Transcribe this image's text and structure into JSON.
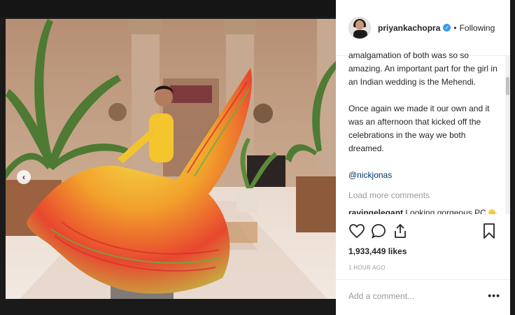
{
  "post": {
    "username": "priyankachopra",
    "separator": "•",
    "follow_status": "Following",
    "verified_glyph": "✓",
    "caption_paragraphs": [
      "amalgamation of both was so so amazing. An important part for the girl in an Indian wedding is the Mehendi.",
      "Once again we made it our own and it was an afternoon that kicked off the celebrations in the way we both dreamed."
    ],
    "mention": "@nickjonas",
    "load_more": "Load more comments",
    "comment": {
      "username": "ravingelegant",
      "text": " Looking gorgeous PC"
    },
    "likes": "1,933,449 likes",
    "timestamp": "1 HOUR AGO",
    "add_comment_placeholder": "Add a comment...",
    "more_glyph": "•••"
  },
  "carousel": {
    "prev_glyph": "‹",
    "dot_count": 5,
    "active_dot": 0
  },
  "icons": [
    "chevron-left-icon",
    "verified-badge-icon",
    "heart-icon",
    "comment-icon",
    "share-icon",
    "bookmark-icon",
    "more-options-icon"
  ],
  "colors": {
    "link": "#003569",
    "verified": "#3897f0",
    "muted": "#999999",
    "text": "#262626"
  }
}
